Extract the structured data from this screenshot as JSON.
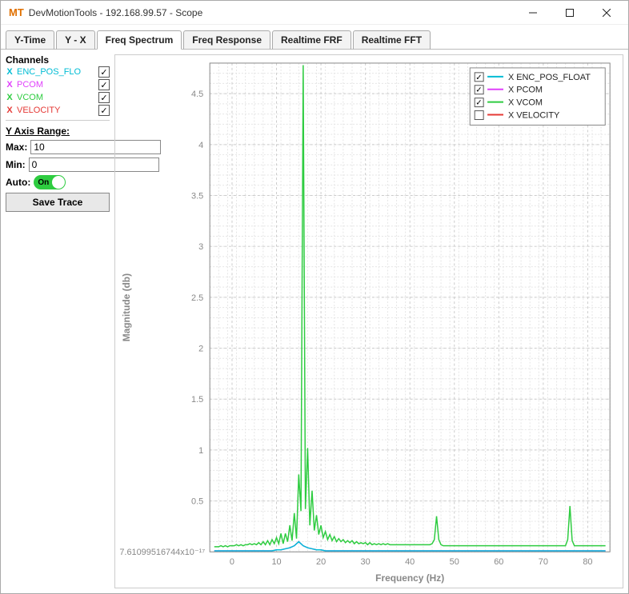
{
  "window": {
    "app_icon": "MT",
    "title": "DevMotionTools - 192.168.99.57 - Scope"
  },
  "tabs": [
    {
      "label": "Y-Time",
      "active": false
    },
    {
      "label": "Y - X",
      "active": false
    },
    {
      "label": "Freq Spectrum",
      "active": true
    },
    {
      "label": "Freq Response",
      "active": false
    },
    {
      "label": "Realtime FRF",
      "active": false
    },
    {
      "label": "Realtime FFT",
      "active": false
    }
  ],
  "sidebar": {
    "channels_label": "Channels",
    "channels": [
      {
        "axis": "X",
        "name": "ENC_POS_FLOAT",
        "color": "#00bcd4",
        "checked": true,
        "display": "ENC_POS_FLO"
      },
      {
        "axis": "X",
        "name": "PCOM",
        "color": "#e040fb",
        "checked": true,
        "display": "PCOM"
      },
      {
        "axis": "X",
        "name": "VCOM",
        "color": "#2ecc40",
        "checked": true,
        "display": "VCOM"
      },
      {
        "axis": "X",
        "name": "VELOCITY",
        "color": "#e53935",
        "checked": true,
        "display": "VELOCITY"
      }
    ],
    "y_range_label": "Y Axis Range:",
    "max_label": "Max:",
    "max_value": "10",
    "min_label": "Min:",
    "min_value": "0",
    "auto_label": "Auto:",
    "auto_state": "On",
    "save_label": "Save Trace"
  },
  "legend": {
    "items": [
      {
        "label": "X ENC_POS_FLOAT",
        "color": "#00bcd4",
        "checked": true
      },
      {
        "label": "X PCOM",
        "color": "#e040fb",
        "checked": true
      },
      {
        "label": "X VCOM",
        "color": "#2ecc40",
        "checked": true
      },
      {
        "label": "X VELOCITY",
        "color": "#e53935",
        "checked": false
      }
    ]
  },
  "chart_data": {
    "type": "line",
    "title": "",
    "xlabel": "Frequency (Hz)",
    "ylabel": "Magnitude (db)",
    "xlim": [
      -5,
      85
    ],
    "ylim": [
      0,
      4.8
    ],
    "x_ticks": [
      0,
      10,
      20,
      30,
      40,
      50,
      60,
      70,
      80
    ],
    "y_ticks": [
      0.5,
      1,
      1.5,
      2,
      2.5,
      3,
      3.5,
      4,
      4.5
    ],
    "y_zero_label": "7.61099516744x10⁻¹⁷",
    "series": [
      {
        "name": "X VCOM",
        "color": "#2ecc40",
        "x_step": 0.5,
        "x_start": -4,
        "values": [
          0.05,
          0.05,
          0.05,
          0.06,
          0.05,
          0.06,
          0.05,
          0.06,
          0.06,
          0.06,
          0.07,
          0.06,
          0.07,
          0.06,
          0.07,
          0.07,
          0.08,
          0.07,
          0.08,
          0.07,
          0.09,
          0.07,
          0.1,
          0.07,
          0.11,
          0.07,
          0.12,
          0.08,
          0.14,
          0.08,
          0.18,
          0.08,
          0.18,
          0.1,
          0.26,
          0.11,
          0.38,
          0.13,
          0.76,
          0.4,
          4.78,
          0.42,
          1.02,
          0.26,
          0.6,
          0.21,
          0.36,
          0.17,
          0.26,
          0.14,
          0.2,
          0.12,
          0.17,
          0.11,
          0.15,
          0.1,
          0.13,
          0.1,
          0.12,
          0.09,
          0.11,
          0.09,
          0.11,
          0.08,
          0.1,
          0.08,
          0.09,
          0.08,
          0.09,
          0.07,
          0.09,
          0.07,
          0.08,
          0.07,
          0.08,
          0.07,
          0.08,
          0.07,
          0.08,
          0.07,
          0.07,
          0.07,
          0.07,
          0.07,
          0.07,
          0.07,
          0.07,
          0.07,
          0.07,
          0.07,
          0.07,
          0.07,
          0.07,
          0.07,
          0.07,
          0.07,
          0.07,
          0.07,
          0.08,
          0.12,
          0.35,
          0.12,
          0.07,
          0.06,
          0.06,
          0.06,
          0.06,
          0.06,
          0.06,
          0.06,
          0.06,
          0.06,
          0.06,
          0.06,
          0.06,
          0.06,
          0.06,
          0.06,
          0.06,
          0.06,
          0.06,
          0.06,
          0.06,
          0.06,
          0.06,
          0.06,
          0.06,
          0.06,
          0.06,
          0.06,
          0.06,
          0.06,
          0.06,
          0.06,
          0.06,
          0.06,
          0.06,
          0.06,
          0.06,
          0.06,
          0.06,
          0.06,
          0.06,
          0.06,
          0.06,
          0.06,
          0.06,
          0.06,
          0.06,
          0.06,
          0.06,
          0.06,
          0.06,
          0.06,
          0.06,
          0.06,
          0.06,
          0.06,
          0.06,
          0.12,
          0.45,
          0.11,
          0.06,
          0.06,
          0.06,
          0.06,
          0.06,
          0.06,
          0.06,
          0.06,
          0.06,
          0.06,
          0.06,
          0.06,
          0.06,
          0.06,
          0.06
        ]
      },
      {
        "name": "X PCOM",
        "color": "#e040fb",
        "x_step": 1,
        "x_start": -4,
        "values": [
          0.01,
          0.01,
          0.01,
          0.01,
          0.01,
          0.01,
          0.01,
          0.01,
          0.01,
          0.01,
          0.01,
          0.01,
          0.01,
          0.01,
          0.02,
          0.02,
          0.03,
          0.04,
          0.06,
          0.1,
          0.06,
          0.04,
          0.03,
          0.02,
          0.02,
          0.01,
          0.01,
          0.01,
          0.01,
          0.01,
          0.01,
          0.01,
          0.01,
          0.01,
          0.01,
          0.01,
          0.01,
          0.01,
          0.01,
          0.01,
          0.01,
          0.01,
          0.01,
          0.01,
          0.01,
          0.01,
          0.01,
          0.01,
          0.01,
          0.01,
          0.01,
          0.01,
          0.01,
          0.01,
          0.01,
          0.01,
          0.01,
          0.01,
          0.01,
          0.01,
          0.01,
          0.01,
          0.01,
          0.01,
          0.01,
          0.01,
          0.01,
          0.01,
          0.01,
          0.01,
          0.01,
          0.01,
          0.01,
          0.01,
          0.01,
          0.01,
          0.01,
          0.01,
          0.01,
          0.01,
          0.01,
          0.01,
          0.01,
          0.01,
          0.01,
          0.01,
          0.01,
          0.01,
          0.01
        ]
      },
      {
        "name": "X ENC_POS_FLOAT",
        "color": "#00bcd4",
        "x_step": 1,
        "x_start": -4,
        "values": [
          0.01,
          0.01,
          0.01,
          0.01,
          0.01,
          0.01,
          0.01,
          0.01,
          0.01,
          0.01,
          0.01,
          0.01,
          0.01,
          0.01,
          0.02,
          0.02,
          0.03,
          0.04,
          0.06,
          0.1,
          0.06,
          0.04,
          0.03,
          0.02,
          0.02,
          0.01,
          0.01,
          0.01,
          0.01,
          0.01,
          0.01,
          0.01,
          0.01,
          0.01,
          0.01,
          0.01,
          0.01,
          0.01,
          0.01,
          0.01,
          0.01,
          0.01,
          0.01,
          0.01,
          0.01,
          0.01,
          0.01,
          0.01,
          0.01,
          0.01,
          0.01,
          0.01,
          0.01,
          0.01,
          0.01,
          0.01,
          0.01,
          0.01,
          0.01,
          0.01,
          0.01,
          0.01,
          0.01,
          0.01,
          0.01,
          0.01,
          0.01,
          0.01,
          0.01,
          0.01,
          0.01,
          0.01,
          0.01,
          0.01,
          0.01,
          0.01,
          0.01,
          0.01,
          0.01,
          0.01,
          0.01,
          0.01,
          0.01,
          0.01,
          0.01,
          0.01,
          0.01,
          0.01,
          0.01
        ]
      }
    ]
  }
}
